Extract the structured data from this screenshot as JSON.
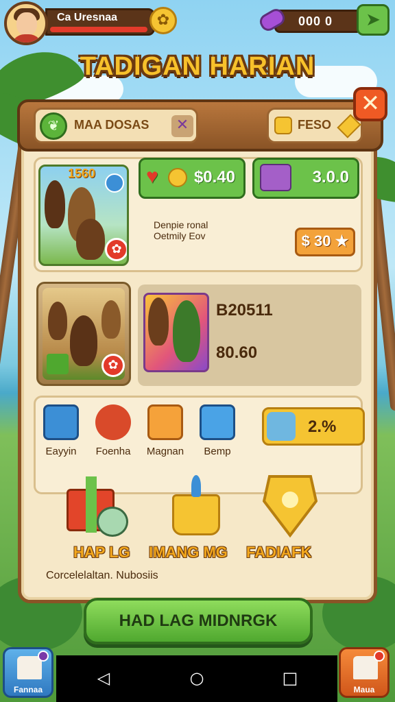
{
  "hud": {
    "player_name": "Ca Uresnaa",
    "gem_count": "000 0",
    "gold_icon": "gold-badge-icon",
    "gem_icon": "purple-gem-icon",
    "send_icon": "send-arrow-icon"
  },
  "title": "TADIGAN HARIAN",
  "panel": {
    "tab_search_label": "MAA DOSAS",
    "tab_feso_label": "FESO",
    "close_label": "✕"
  },
  "row1": {
    "card_label": "1560",
    "price_green_1": "$0.40",
    "price_green_2": "3.0.0",
    "description_line1": "Denpie ronal",
    "description_line2": "Oetmily Eov",
    "orange_price": "$ 30 ★"
  },
  "row2": {
    "value_1": "B20511",
    "value_2": "80.60"
  },
  "row3": {
    "items": [
      {
        "label": "Eayyin"
      },
      {
        "label": "Foenha"
      },
      {
        "label": "Magnan"
      },
      {
        "label": "Bemp"
      }
    ],
    "percent": "2.%"
  },
  "rewards": {
    "label_1": "HAP LG",
    "label_2": "IMANG MG",
    "label_3": "FADIAFK"
  },
  "footer_note": "Corcelelaltan. Nubosiis",
  "main_button": "HAD LAG MIDNRGK",
  "side_buttons": {
    "left_label": "Fannaa",
    "right_label": "Maua"
  },
  "colors": {
    "accent_green": "#6cc24a",
    "accent_orange": "#f3a23a",
    "title_gold": "#f7c12b",
    "wood": "#8a5426"
  }
}
